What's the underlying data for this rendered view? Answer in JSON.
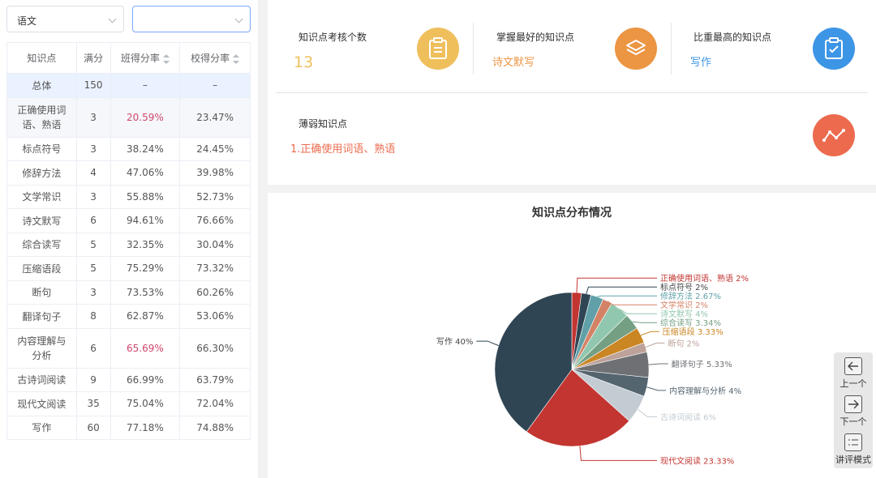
{
  "filters": {
    "subject": "语文",
    "class": ""
  },
  "table": {
    "headers": [
      "知识点",
      "满分",
      "班得分率",
      "校得分率"
    ],
    "rows": [
      {
        "name": "总体",
        "full": "150",
        "class_rate": "–",
        "school_rate": "–"
      },
      {
        "name": "正确使用词语、熟语",
        "full": "3",
        "class_rate": "20.59%",
        "school_rate": "23.47%"
      },
      {
        "name": "标点符号",
        "full": "3",
        "class_rate": "38.24%",
        "school_rate": "24.45%"
      },
      {
        "name": "修辞方法",
        "full": "4",
        "class_rate": "47.06%",
        "school_rate": "39.98%"
      },
      {
        "name": "文学常识",
        "full": "3",
        "class_rate": "55.88%",
        "school_rate": "52.73%"
      },
      {
        "name": "诗文默写",
        "full": "6",
        "class_rate": "94.61%",
        "school_rate": "76.66%"
      },
      {
        "name": "综合读写",
        "full": "5",
        "class_rate": "32.35%",
        "school_rate": "30.04%"
      },
      {
        "name": "压缩语段",
        "full": "5",
        "class_rate": "75.29%",
        "school_rate": "73.32%"
      },
      {
        "name": "断句",
        "full": "3",
        "class_rate": "73.53%",
        "school_rate": "60.26%"
      },
      {
        "name": "翻译句子",
        "full": "8",
        "class_rate": "62.87%",
        "school_rate": "53.06%"
      },
      {
        "name": "内容理解与分析",
        "full": "6",
        "class_rate": "65.69%",
        "school_rate": "66.30%"
      },
      {
        "name": "古诗词阅读",
        "full": "9",
        "class_rate": "66.99%",
        "school_rate": "63.79%"
      },
      {
        "name": "现代文阅读",
        "full": "35",
        "class_rate": "75.04%",
        "school_rate": "72.04%"
      },
      {
        "name": "写作",
        "full": "60",
        "class_rate": "77.18%",
        "school_rate": "74.88%"
      }
    ]
  },
  "stats": {
    "count_label": "知识点考核个数",
    "count_value": "13",
    "best_label": "掌握最好的知识点",
    "best_value": "诗文默写",
    "highest_label": "比重最高的知识点",
    "highest_value": "写作",
    "weak_label": "薄弱知识点",
    "weak_value": "1.正确使用词语、熟语",
    "icons": [
      "clipboard-icon",
      "layers-icon",
      "checklist-icon",
      "trend-icon"
    ],
    "colors": {
      "yellow": "#efbf5c",
      "orange": "#ec9543",
      "blue": "#3d95e6",
      "red": "#ec6b4f"
    }
  },
  "chart_data": {
    "type": "pie",
    "title": "知识点分布情况",
    "slices": [
      {
        "name": "正确使用词语、熟语",
        "value": 2,
        "label": "正确使用词语、熟语 2%",
        "color": "#c23531"
      },
      {
        "name": "标点符号",
        "value": 2,
        "label": "标点符号 2%",
        "color": "#2f4554"
      },
      {
        "name": "修辞方法",
        "value": 2.67,
        "label": "修辞方法 2.67%",
        "color": "#61a0a8"
      },
      {
        "name": "文学常识",
        "value": 2,
        "label": "文学常识 2%",
        "color": "#d48265"
      },
      {
        "name": "诗文默写",
        "value": 4,
        "label": "诗文默写 4%",
        "color": "#91c7ae"
      },
      {
        "name": "综合读写",
        "value": 3.34,
        "label": "综合读写 3.34%",
        "color": "#749f83"
      },
      {
        "name": "压缩语段",
        "value": 3.33,
        "label": "压缩语段 3.33%",
        "color": "#ca8622"
      },
      {
        "name": "断句",
        "value": 2,
        "label": "断句 2%",
        "color": "#bda29a"
      },
      {
        "name": "翻译句子",
        "value": 5.33,
        "label": "翻译句子 5.33%",
        "color": "#6e7074"
      },
      {
        "name": "内容理解与分析",
        "value": 4,
        "label": "内容理解与分析 4%",
        "color": "#546570"
      },
      {
        "name": "古诗词阅读",
        "value": 6,
        "label": "古诗词阅读 6%",
        "color": "#c4ccd3"
      },
      {
        "name": "现代文阅读",
        "value": 23.33,
        "label": "现代文阅读 23.33%",
        "color": "#c23531"
      },
      {
        "name": "写作",
        "value": 40,
        "label": "写作 40%",
        "color": "#2f4554"
      }
    ]
  },
  "nav": {
    "prev": "上一个",
    "next": "下一个",
    "mode": "讲评模式"
  }
}
